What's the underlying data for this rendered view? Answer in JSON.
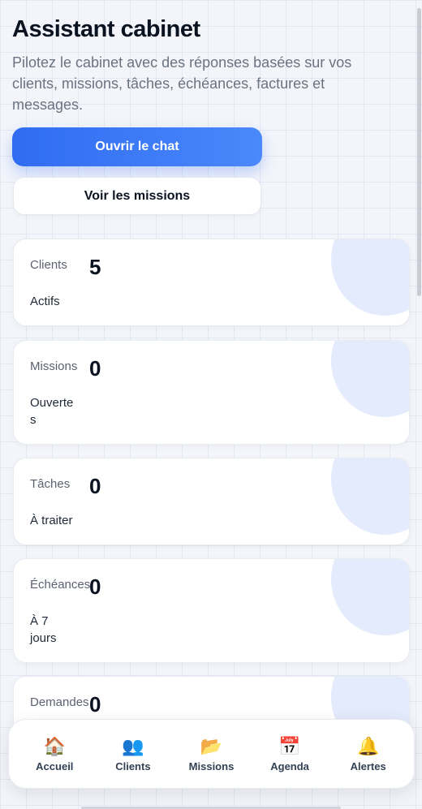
{
  "header": {
    "title": "Assistant cabinet",
    "subtitle": "Pilotez le cabinet avec des réponses basées sur vos clients, missions, tâches, échéances, factures et messages."
  },
  "actions": {
    "primary_label": "Ouvrir le chat",
    "secondary_label": "Voir les missions"
  },
  "stats": [
    {
      "label": "Clients",
      "value": "5",
      "sub": "Actifs"
    },
    {
      "label": "Missions",
      "value": "0",
      "sub": "Ouvertes"
    },
    {
      "label": "Tâches",
      "value": "0",
      "sub": "À traiter"
    },
    {
      "label": "Échéances",
      "value": "0",
      "sub": "À 7 jours"
    },
    {
      "label": "Demandes",
      "value": "0",
      "sub": ""
    }
  ],
  "nav": [
    {
      "label": "Accueil",
      "icon": "home-icon",
      "glyph": "🏠"
    },
    {
      "label": "Clients",
      "icon": "users-icon",
      "glyph": "👥"
    },
    {
      "label": "Missions",
      "icon": "folder-icon",
      "glyph": "📂"
    },
    {
      "label": "Agenda",
      "icon": "calendar-icon",
      "glyph": "📅"
    },
    {
      "label": "Alertes",
      "icon": "bell-icon",
      "glyph": "🔔"
    }
  ],
  "colors": {
    "accent": "#2f6cf2",
    "card_deco": "#e3ebfc",
    "background": "#f3f5fa"
  }
}
